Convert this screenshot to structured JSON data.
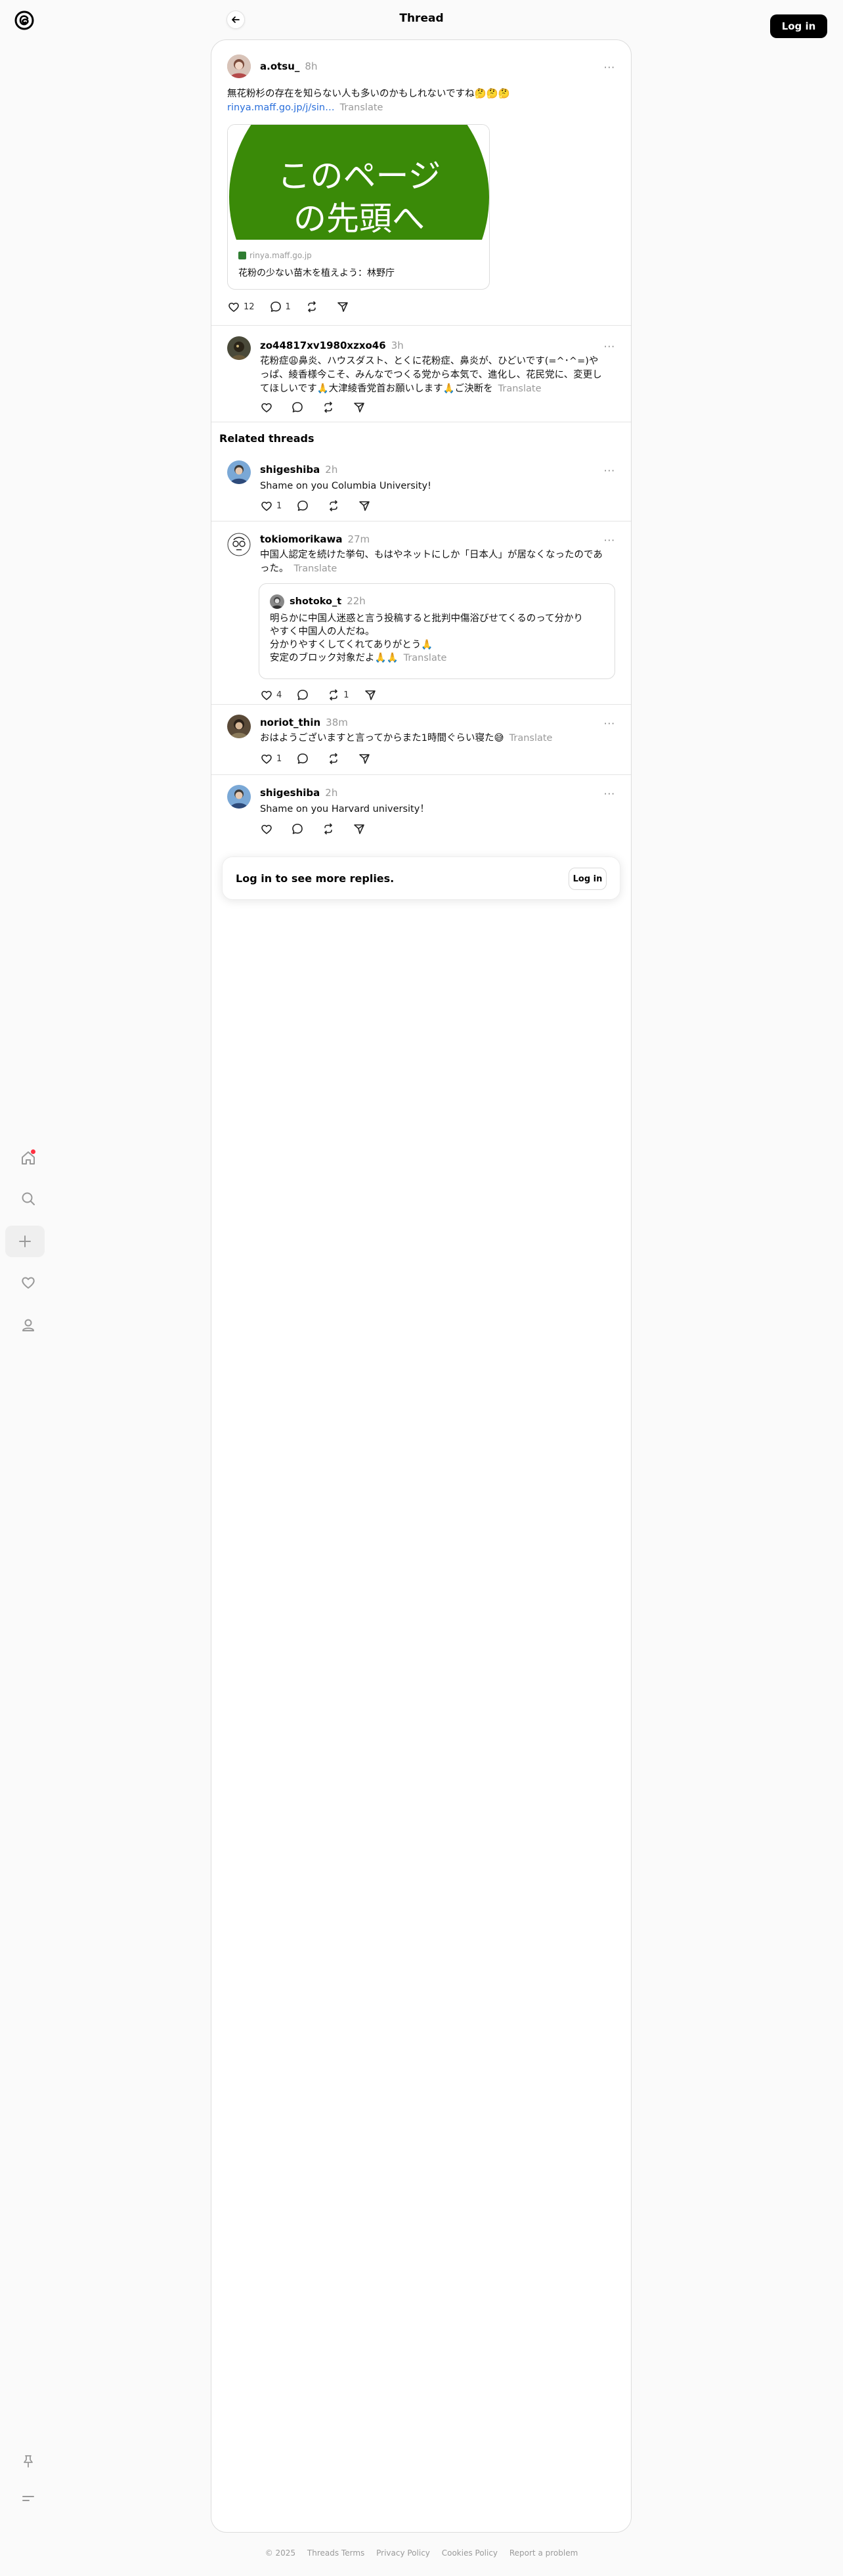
{
  "header": {
    "title": "Thread",
    "login_label": "Log in"
  },
  "sidenav": {
    "items": [
      "home-icon",
      "search-icon",
      "create-icon",
      "activity-heart-icon",
      "profile-icon"
    ],
    "bottom": [
      "pin-icon",
      "menu-icon"
    ]
  },
  "main_post": {
    "username": "a.otsu_",
    "time": "8h",
    "line1": "無花粉杉の存在を知らない人も多いのかもしれないですね🤔🤔🤔",
    "link_text": "rinya.maff.go.jp/j/sin…",
    "translate": "Translate",
    "card": {
      "image_line1": "このページ",
      "image_line2": "の先頭へ",
      "domain": "rinya.maff.go.jp",
      "title": "花粉の少ない苗木を植えよう：林野庁"
    },
    "likes": "12",
    "replies": "1"
  },
  "reply": {
    "username": "zo44817xv1980xzxo46",
    "time": "3h",
    "line1": "花粉症😩鼻炎、ハウスダスト、とくに花粉症、鼻炎が、ひどいです(=^･^=)や",
    "line2": "っぱ、綾香様今こそ、みんなでつくる党から本気で、進化し、花民党に、変更し",
    "line3": "てほしいです🙏大津綾香党首お願いします🙏ご決断を",
    "translate": "Translate"
  },
  "related": {
    "heading": "Related threads",
    "posts": [
      {
        "username": "shigeshiba",
        "time": "2h",
        "text": "Shame on you Columbia University!",
        "likes": "1"
      },
      {
        "username": "tokiomorikawa",
        "time": "27m",
        "line1": "中国人認定を続けた挙句、もはやネットにしか「日本人」が居なくなったのであ",
        "line2": "った。",
        "translate": "Translate",
        "quote": {
          "username": "shotoko_t",
          "time": "22h",
          "line1": "明らかに中国人迷惑と言う投稿すると批判中傷浴びせてくるのって分かり",
          "line2": "やすく中国人の人だね。",
          "line3": "分かりやすくしてくれてありがとう🙏",
          "line4": "安定のブロック対象だよ🙏🙏",
          "translate": "Translate"
        },
        "likes": "4",
        "reposts": "1"
      },
      {
        "username": "noriot_thin",
        "time": "38m",
        "text": "おはようございますと言ってからまた1時間ぐらい寝た😅",
        "translate": "Translate",
        "likes": "1"
      },
      {
        "username": "shigeshiba",
        "time": "2h",
        "text": "Shame on you Harvard university！"
      }
    ]
  },
  "login_prompt": {
    "text": "Log in to see more replies.",
    "button": "Log in"
  },
  "footer": {
    "items": [
      "© 2025",
      "Threads Terms",
      "Privacy Policy",
      "Cookies Policy",
      "Report a problem"
    ]
  },
  "colors": {
    "accent_link": "#2a6fdb",
    "notification_dot": "#ff3040",
    "card_green": "#3a8a08"
  }
}
